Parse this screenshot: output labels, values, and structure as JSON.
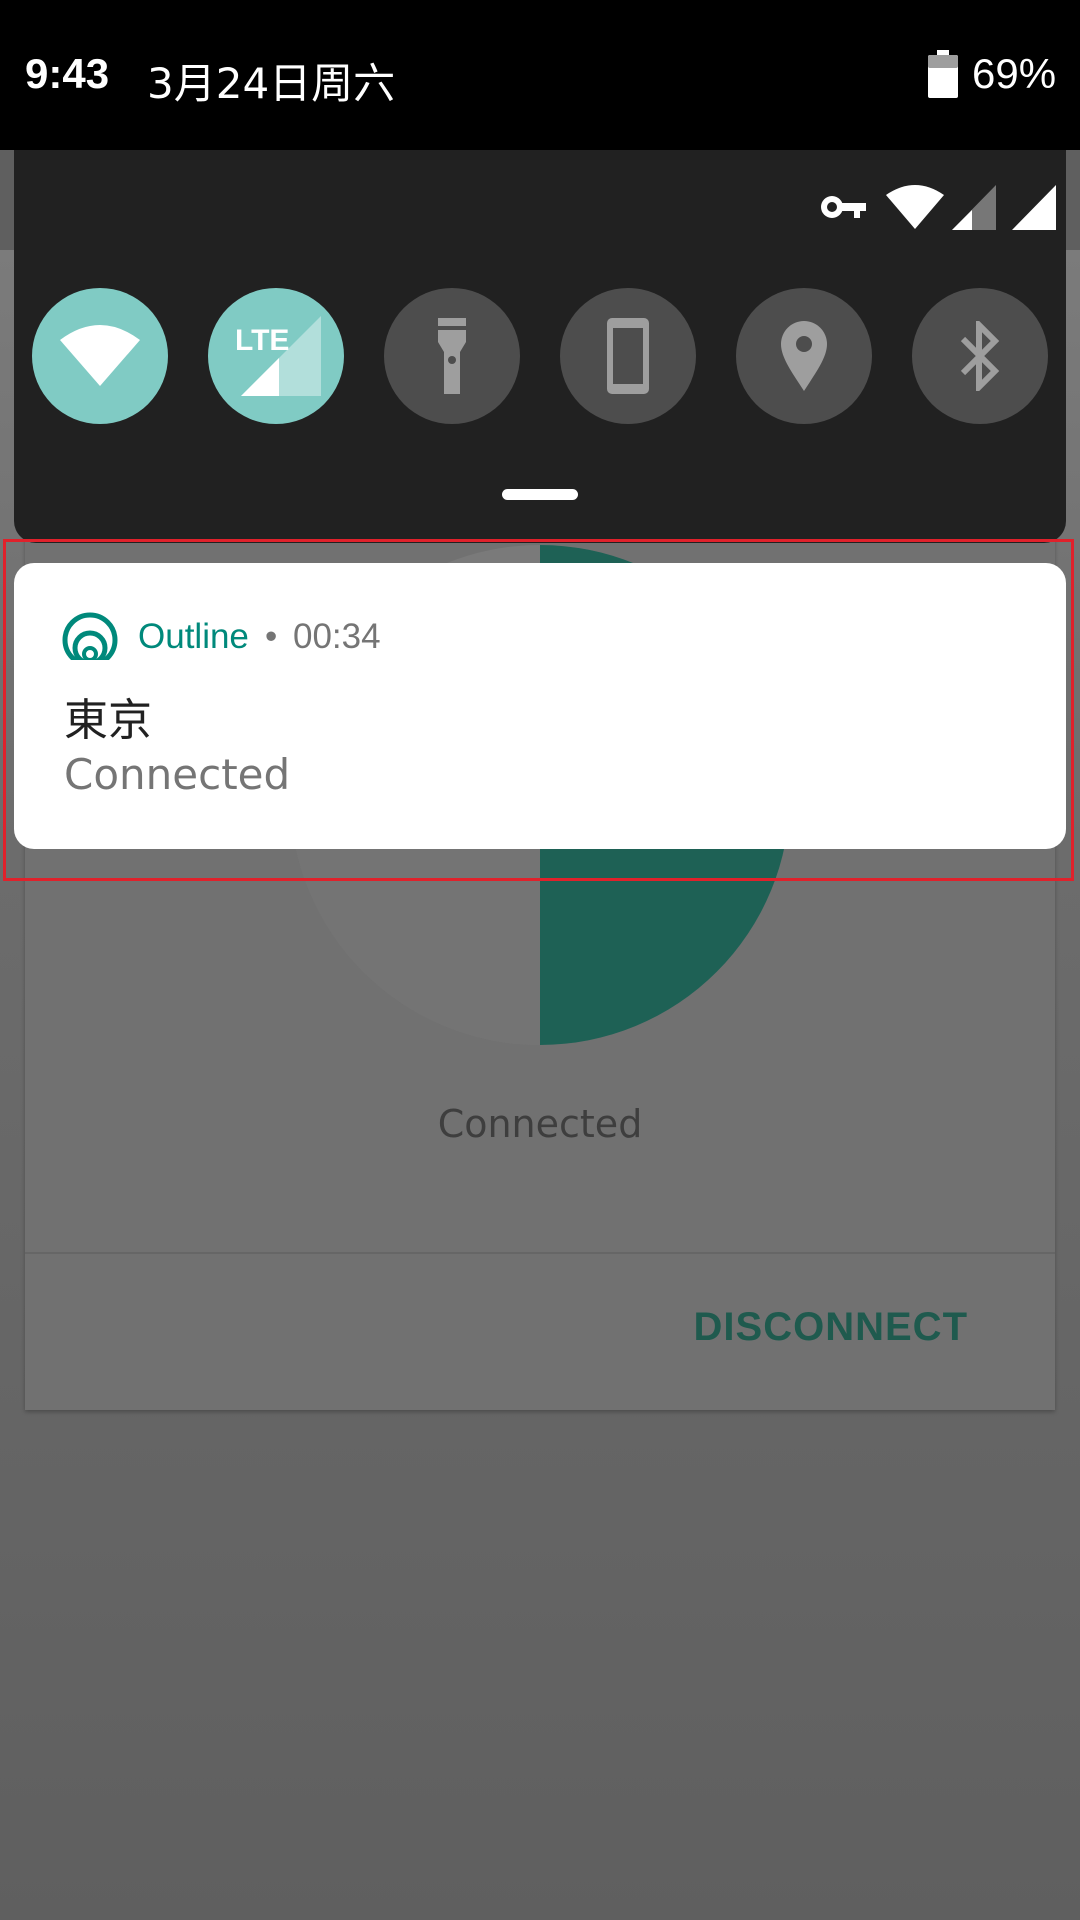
{
  "status_bar": {
    "time": "9:43",
    "date": "3月24日周六",
    "battery": "69%",
    "icons": [
      "battery-icon",
      "vpn-key-icon",
      "wifi-icon",
      "signal-icon",
      "signal-icon"
    ]
  },
  "quick_settings": {
    "tiles": [
      {
        "name": "wifi-icon",
        "state": "on"
      },
      {
        "name": "lte-signal-icon",
        "state": "on",
        "label": "LTE"
      },
      {
        "name": "flashlight-icon",
        "state": "off"
      },
      {
        "name": "auto-rotate-icon",
        "state": "off"
      },
      {
        "name": "location-icon",
        "state": "off"
      },
      {
        "name": "bluetooth-icon",
        "state": "off"
      }
    ],
    "accent_on": "#80cbc4",
    "tile_off": "#4d4d4d"
  },
  "notification": {
    "app_name": "Outline",
    "separator": "•",
    "time": "00:34",
    "title": "東京",
    "text": "Connected",
    "accent": "#00897b",
    "icon": "outline-logo-icon"
  },
  "app": {
    "status": "Connected",
    "disconnect_label": "DISCONNECT"
  }
}
